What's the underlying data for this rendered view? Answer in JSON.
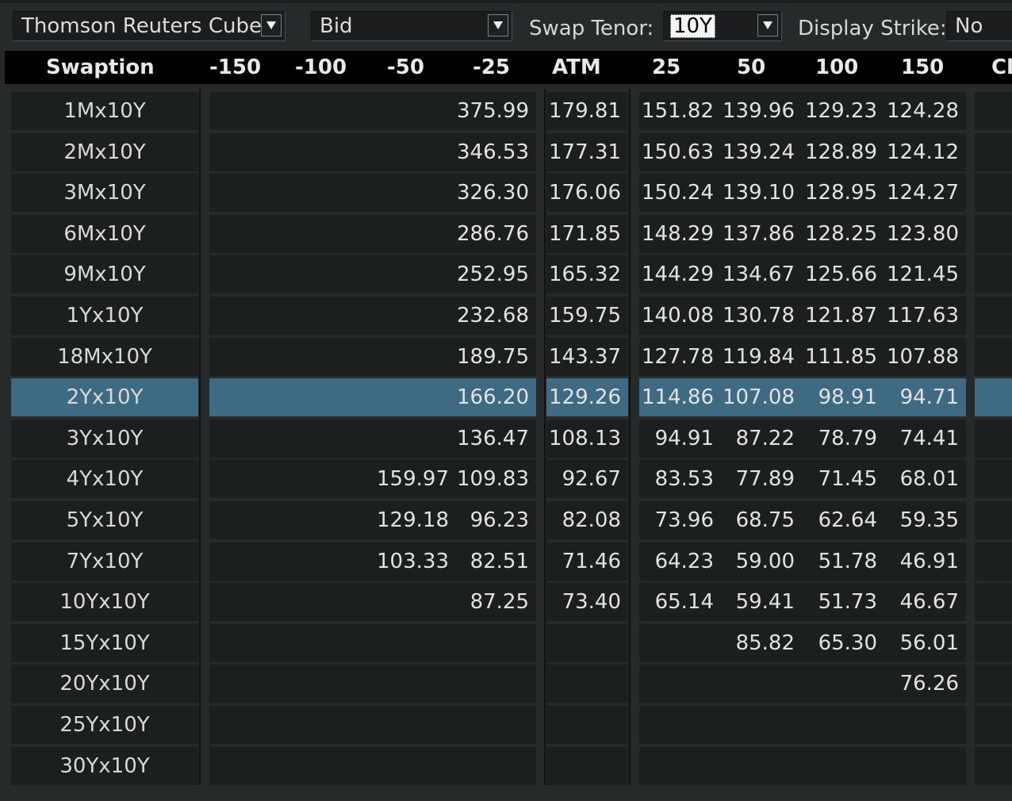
{
  "toolbar": {
    "source": "Thomson Reuters Cube",
    "side": "Bid",
    "swap_tenor_label": "Swap Tenor:",
    "swap_tenor_value": "10Y",
    "display_strike_label": "Display Strike:",
    "display_strike_value": "No"
  },
  "table": {
    "headers": [
      "Swaption",
      "-150",
      "-100",
      "-50",
      "-25",
      "ATM",
      "25",
      "50",
      "100",
      "150",
      "Cl"
    ],
    "selected_row": "2Yx10Y",
    "rows": [
      {
        "label": "1Mx10Y",
        "m150": "",
        "m100": "",
        "m50": "",
        "m25": "375.99",
        "atm": "179.81",
        "p25": "151.82",
        "p50": "139.96",
        "p100": "129.23",
        "p150": "124.28"
      },
      {
        "label": "2Mx10Y",
        "m150": "",
        "m100": "",
        "m50": "",
        "m25": "346.53",
        "atm": "177.31",
        "p25": "150.63",
        "p50": "139.24",
        "p100": "128.89",
        "p150": "124.12"
      },
      {
        "label": "3Mx10Y",
        "m150": "",
        "m100": "",
        "m50": "",
        "m25": "326.30",
        "atm": "176.06",
        "p25": "150.24",
        "p50": "139.10",
        "p100": "128.95",
        "p150": "124.27"
      },
      {
        "label": "6Mx10Y",
        "m150": "",
        "m100": "",
        "m50": "",
        "m25": "286.76",
        "atm": "171.85",
        "p25": "148.29",
        "p50": "137.86",
        "p100": "128.25",
        "p150": "123.80"
      },
      {
        "label": "9Mx10Y",
        "m150": "",
        "m100": "",
        "m50": "",
        "m25": "252.95",
        "atm": "165.32",
        "p25": "144.29",
        "p50": "134.67",
        "p100": "125.66",
        "p150": "121.45"
      },
      {
        "label": "1Yx10Y",
        "m150": "",
        "m100": "",
        "m50": "",
        "m25": "232.68",
        "atm": "159.75",
        "p25": "140.08",
        "p50": "130.78",
        "p100": "121.87",
        "p150": "117.63"
      },
      {
        "label": "18Mx10Y",
        "m150": "",
        "m100": "",
        "m50": "",
        "m25": "189.75",
        "atm": "143.37",
        "p25": "127.78",
        "p50": "119.84",
        "p100": "111.85",
        "p150": "107.88"
      },
      {
        "label": "2Yx10Y",
        "m150": "",
        "m100": "",
        "m50": "",
        "m25": "166.20",
        "atm": "129.26",
        "p25": "114.86",
        "p50": "107.08",
        "p100": "98.91",
        "p150": "94.71"
      },
      {
        "label": "3Yx10Y",
        "m150": "",
        "m100": "",
        "m50": "",
        "m25": "136.47",
        "atm": "108.13",
        "p25": "94.91",
        "p50": "87.22",
        "p100": "78.79",
        "p150": "74.41"
      },
      {
        "label": "4Yx10Y",
        "m150": "",
        "m100": "",
        "m50": "159.97",
        "m25": "109.83",
        "atm": "92.67",
        "p25": "83.53",
        "p50": "77.89",
        "p100": "71.45",
        "p150": "68.01"
      },
      {
        "label": "5Yx10Y",
        "m150": "",
        "m100": "",
        "m50": "129.18",
        "m25": "96.23",
        "atm": "82.08",
        "p25": "73.96",
        "p50": "68.75",
        "p100": "62.64",
        "p150": "59.35"
      },
      {
        "label": "7Yx10Y",
        "m150": "",
        "m100": "",
        "m50": "103.33",
        "m25": "82.51",
        "atm": "71.46",
        "p25": "64.23",
        "p50": "59.00",
        "p100": "51.78",
        "p150": "46.91"
      },
      {
        "label": "10Yx10Y",
        "m150": "",
        "m100": "",
        "m50": "",
        "m25": "87.25",
        "atm": "73.40",
        "p25": "65.14",
        "p50": "59.41",
        "p100": "51.73",
        "p150": "46.67"
      },
      {
        "label": "15Yx10Y",
        "m150": "",
        "m100": "",
        "m50": "",
        "m25": "",
        "atm": "",
        "p25": "",
        "p50": "85.82",
        "p100": "65.30",
        "p150": "56.01"
      },
      {
        "label": "20Yx10Y",
        "m150": "",
        "m100": "",
        "m50": "",
        "m25": "",
        "atm": "",
        "p25": "",
        "p50": "",
        "p100": "",
        "p150": "76.26"
      },
      {
        "label": "25Yx10Y",
        "m150": "",
        "m100": "",
        "m50": "",
        "m25": "",
        "atm": "",
        "p25": "",
        "p50": "",
        "p100": "",
        "p150": ""
      },
      {
        "label": "30Yx10Y",
        "m150": "",
        "m100": "",
        "m50": "",
        "m25": "",
        "atm": "",
        "p25": "",
        "p50": "",
        "p100": "",
        "p150": ""
      }
    ]
  },
  "colors": {
    "background": "#262a2b",
    "cell": "#1c1f20",
    "selected": "#3f6a84",
    "header_bg": "#000000"
  }
}
